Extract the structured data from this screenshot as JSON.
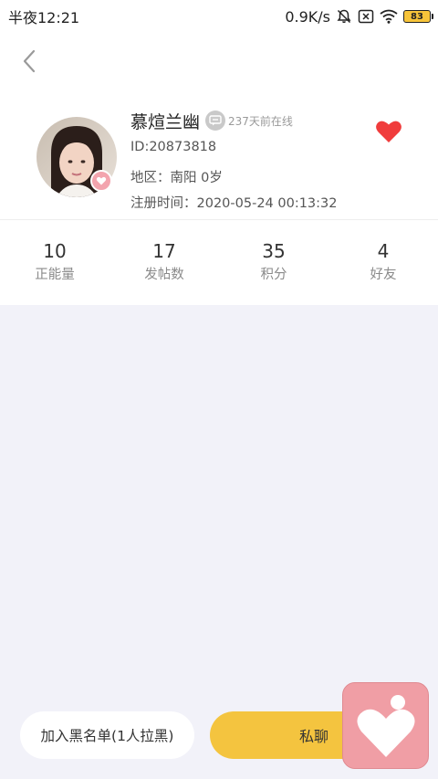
{
  "status_bar": {
    "time": "半夜12:21",
    "network_speed": "0.9K/s",
    "battery": "83",
    "icons": [
      "bell-off-icon",
      "sim-disabled-icon",
      "wifi-icon",
      "battery-icon"
    ]
  },
  "header": {
    "back_icon": "chevron-left-icon"
  },
  "profile": {
    "nickname": "慕煊兰幽",
    "last_online": "237天前在线",
    "id_line": "ID:20873818",
    "region_line": "地区：南阳 0岁",
    "register_line": "注册时间：2020-05-24 00:13:32",
    "favorite_icon": "heart-icon",
    "favorite_color": "#f03c3c"
  },
  "stats": [
    {
      "value": "10",
      "label": "正能量"
    },
    {
      "value": "17",
      "label": "发帖数"
    },
    {
      "value": "35",
      "label": "积分"
    },
    {
      "value": "4",
      "label": "好友"
    }
  ],
  "actions": {
    "blacklist_label": "加入黑名单(1人拉黑)",
    "chat_label": "私聊",
    "chat_color": "#f4c43f"
  },
  "floating": {
    "icon": "app-heart-logo-icon",
    "color": "#f09ea5"
  }
}
